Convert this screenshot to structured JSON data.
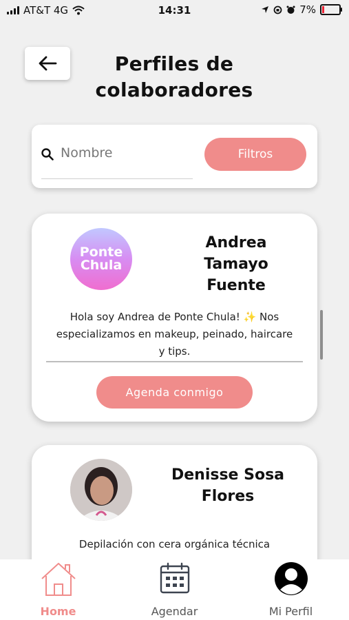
{
  "status_bar": {
    "carrier": "AT&T 4G",
    "time": "14:31",
    "battery": "7%"
  },
  "header": {
    "title": "Perfiles de colaboradores"
  },
  "search": {
    "placeholder": "Nombre",
    "filters_label": "Filtros"
  },
  "profiles": [
    {
      "name": "Andrea Tamayo Fuente",
      "avatar_text": "Ponte Chula",
      "bio": "Hola soy Andrea de Ponte Chula! ✨ Nos especializamos en makeup, peinado, haircare y tips.",
      "button_label": "Agenda conmigo"
    },
    {
      "name": "Denisse Sosa Flores",
      "bio": "Depilación con cera orgánica técnica"
    }
  ],
  "tabs": [
    {
      "label": "Home",
      "icon": "home-icon",
      "active": true
    },
    {
      "label": "Agendar",
      "icon": "calendar-icon",
      "active": false
    },
    {
      "label": "Mi Perfil",
      "icon": "user-icon",
      "active": false
    }
  ],
  "colors": {
    "accent": "#f08c8b",
    "background": "#f0f0f0",
    "card": "#ffffff"
  }
}
